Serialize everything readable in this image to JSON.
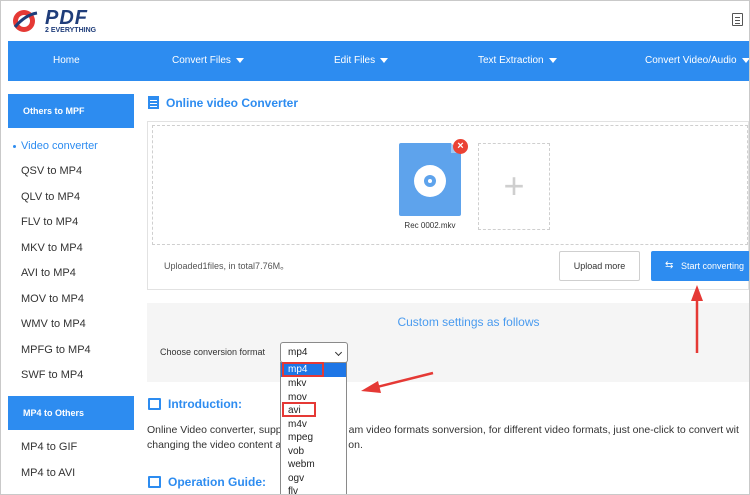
{
  "header": {
    "logo_text": "PDF",
    "logo_subtitle": "2 EVERYTHING"
  },
  "nav": {
    "items": [
      {
        "label": "Home",
        "has_dropdown": false
      },
      {
        "label": "Convert Files",
        "has_dropdown": true
      },
      {
        "label": "Edit Files",
        "has_dropdown": true
      },
      {
        "label": "Text Extraction",
        "has_dropdown": true
      },
      {
        "label": "Convert Video/Audio",
        "has_dropdown": true
      }
    ]
  },
  "sidebar": {
    "group1_title": "Others to MPF",
    "group1_items": [
      "Video converter",
      "QSV to MP4",
      "QLV to MP4",
      "FLV to MP4",
      "MKV to MP4",
      "AVI to MP4",
      "MOV to MP4",
      "WMV to MP4",
      "MPFG to MP4",
      "SWF to MP4"
    ],
    "group2_title": "MP4 to Others",
    "group2_items": [
      "MP4 to GIF",
      "MP4 to AVI"
    ]
  },
  "main": {
    "title": "Online video Converter",
    "file_name": "Rec 0002.mkv",
    "upload_status": "Uploaded1files, in total7.76M。",
    "upload_more_label": "Upload more",
    "start_label": "Start converting",
    "add_symbol": "+",
    "remove_symbol": "×"
  },
  "settings": {
    "title": "Custom settings as follows",
    "format_label": "Choose conversion format",
    "selected_format": "mp4",
    "options": [
      "mp4",
      "mkv",
      "mov",
      "avi",
      "m4v",
      "mpeg",
      "vob",
      "webm",
      "ogv",
      "flv"
    ]
  },
  "intro": {
    "title": "Introduction:",
    "line1_a": "Online Video converter, supp",
    "line1_b": "am video formats sonversion, for different video formats, just one-click to convert wit",
    "line2_a": "changing the video content a",
    "line2_b": "on."
  },
  "guide": {
    "title": "Operation Guide:"
  },
  "colors": {
    "brand_blue": "#2d8cf0",
    "annotation_red": "#e53935"
  }
}
